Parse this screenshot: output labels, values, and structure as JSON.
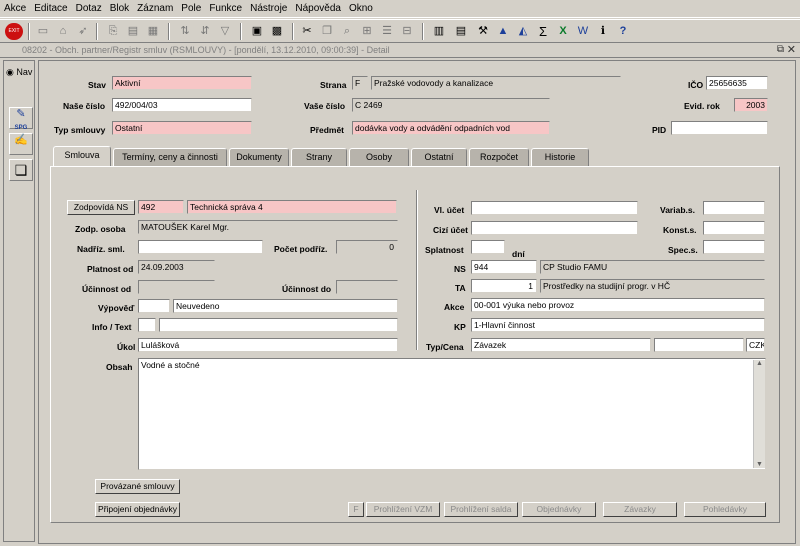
{
  "menu": [
    "Akce",
    "Editace",
    "Dotaz",
    "Blok",
    "Záznam",
    "Pole",
    "Funkce",
    "Nástroje",
    "Nápověda",
    "Okno"
  ],
  "toolbar": {
    "exit_label": "EXIT"
  },
  "window": {
    "title": "08202 - Obch. partner/Registr smluv (RSMLOUVY) - [pondělí, 13.12.2010, 09:00:39] - Detail",
    "nav_label": "Nav",
    "spg_label": "SPG"
  },
  "header": {
    "stav_label": "Stav",
    "stav": "Aktivní",
    "cislo_label": "Naše číslo",
    "cislo": "492/004/03",
    "typ_label": "Typ smlouvy",
    "typ": "Ostatní",
    "strana_label": "Strana",
    "strana_code": "F",
    "strana_name": "Pražské vodovody a kanalizace",
    "vase_cislo_label": "Vaše číslo",
    "vase_cislo": "C 2469",
    "predmet_label": "Předmět",
    "predmet": "dodávka vody a odvádění odpadních vod",
    "ico_label": "IČO",
    "ico": "25656635",
    "evid_rok_label": "Evid. rok",
    "evid_rok": "2003",
    "pid_label": "PID",
    "pid": ""
  },
  "tabs": [
    "Smlouva",
    "Termíny, ceny a činnosti",
    "Dokumenty",
    "Strany",
    "Osoby",
    "Ostatní",
    "Rozpočet",
    "Historie"
  ],
  "form": {
    "zodpovida_btn": "Zodpovídá NS",
    "zodpovida_code": "492",
    "zodpovida_name": "Technická správa 4",
    "zodp_osoba_label": "Zodp. osoba",
    "zodp_osoba": "MATOUŠEK Karel Mgr.",
    "nadriz_label": "Nadříz. sml.",
    "nadriz": "",
    "pocet_label": "Počet podříz.",
    "pocet": "0",
    "platnost_label": "Platnost od",
    "platnost": "24.09.2003",
    "ucinnost_od_label": "Účinnost od",
    "ucinnost_od": "",
    "ucinnost_do_label": "Účinnost do",
    "ucinnost_do": "",
    "vypoved_label": "Výpověď",
    "vypoved_code": "",
    "vypoved_text": "Neuvedeno",
    "info_label": "Info / Text",
    "info_code": "",
    "info_text": "",
    "ukol_label": "Úkol",
    "ukol": "Lulášková",
    "vl_ucet_label": "Vl. účet",
    "vl_ucet": "",
    "cizi_ucet_label": "Cizí účet",
    "cizi_ucet": "",
    "splatnost_label": "Splatnost",
    "splatnost": "",
    "dni": "dní",
    "variab_label": "Variab.s.",
    "variab": "",
    "konst_label": "Konst.s.",
    "konst": "",
    "spec_label": "Spec.s.",
    "spec": "",
    "ns_label": "NS",
    "ns_code": "944",
    "ns_name": "CP Studio FAMU",
    "ta_label": "TA",
    "ta_code": "1",
    "ta_name": "Prostředky na studijní progr. v HČ",
    "akce_label": "Akce",
    "akce": "00-001 výuka nebo provoz",
    "kp_label": "KP",
    "kp": "1-Hlavní činnost",
    "typcena_label": "Typ/Cena",
    "typcena": "Závazek",
    "cena": "",
    "mena": "CZK",
    "obsah_label": "Obsah",
    "obsah": "Vodné a stočné"
  },
  "buttons": {
    "provazane": "Provázané smlouvy",
    "pripojeni": "Připojení objednávky",
    "f": "F",
    "vzm": "Prohlížení VZM",
    "salda": "Prohlížení salda",
    "objednavky": "Objednávky",
    "zavazky": "Závazky",
    "pohledavky": "Pohledávky"
  }
}
